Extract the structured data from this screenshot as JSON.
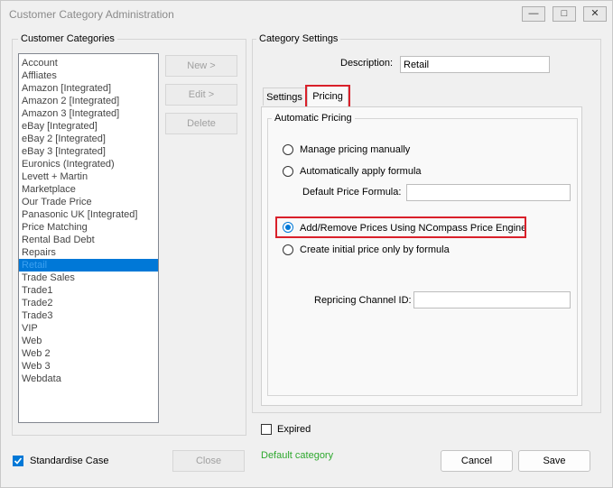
{
  "window": {
    "title": "Customer Category Administration",
    "minimize_glyph": "—",
    "maximize_glyph": "□",
    "close_glyph": "✕"
  },
  "left": {
    "group_label": "Customer Categories",
    "categories": [
      "Account",
      "Affliates",
      "Amazon [Integrated]",
      "Amazon 2 [Integrated]",
      "Amazon 3 [Integrated]",
      "eBay [Integrated]",
      "eBay 2 [Integrated]",
      "eBay 3 [Integrated]",
      "Euronics (Integrated)",
      "Levett + Martin",
      "Marketplace",
      "Our Trade Price",
      "Panasonic UK [Integrated]",
      "Price Matching",
      "Rental Bad Debt",
      "Repairs",
      "Retail",
      "Trade Sales",
      "Trade1",
      "Trade2",
      "Trade3",
      "VIP",
      "Web",
      "Web 2",
      "Web 3",
      "Webdata"
    ],
    "selected_category": "Retail",
    "new_button": "New >",
    "edit_button": "Edit >",
    "delete_button": "Delete",
    "standardise_label": "Standardise Case",
    "standardise_checked": true,
    "close_button": "Close"
  },
  "right": {
    "group_label": "Category Settings",
    "description_label": "Description:",
    "description_value": "Retail",
    "tabs": {
      "settings": "Settings",
      "pricing": "Pricing",
      "active": "Pricing"
    },
    "auto_pricing": {
      "group_label": "Automatic Pricing",
      "options": {
        "manual": "Manage pricing manually",
        "formula": "Automatically apply formula",
        "engine": "Add/Remove Prices Using NCompass Price Engine",
        "initial": "Create initial price only by formula"
      },
      "selected": "engine",
      "default_formula_label": "Default Price Formula:",
      "default_formula_value": "",
      "repricing_label": "Repricing Channel ID:",
      "repricing_value": ""
    },
    "expired_label": "Expired",
    "expired_checked": false,
    "status_text": "Default category",
    "cancel_button": "Cancel",
    "save_button": "Save"
  },
  "colors": {
    "accent": "#0078d7",
    "highlight": "#d9202a",
    "status": "#2ea82e"
  }
}
